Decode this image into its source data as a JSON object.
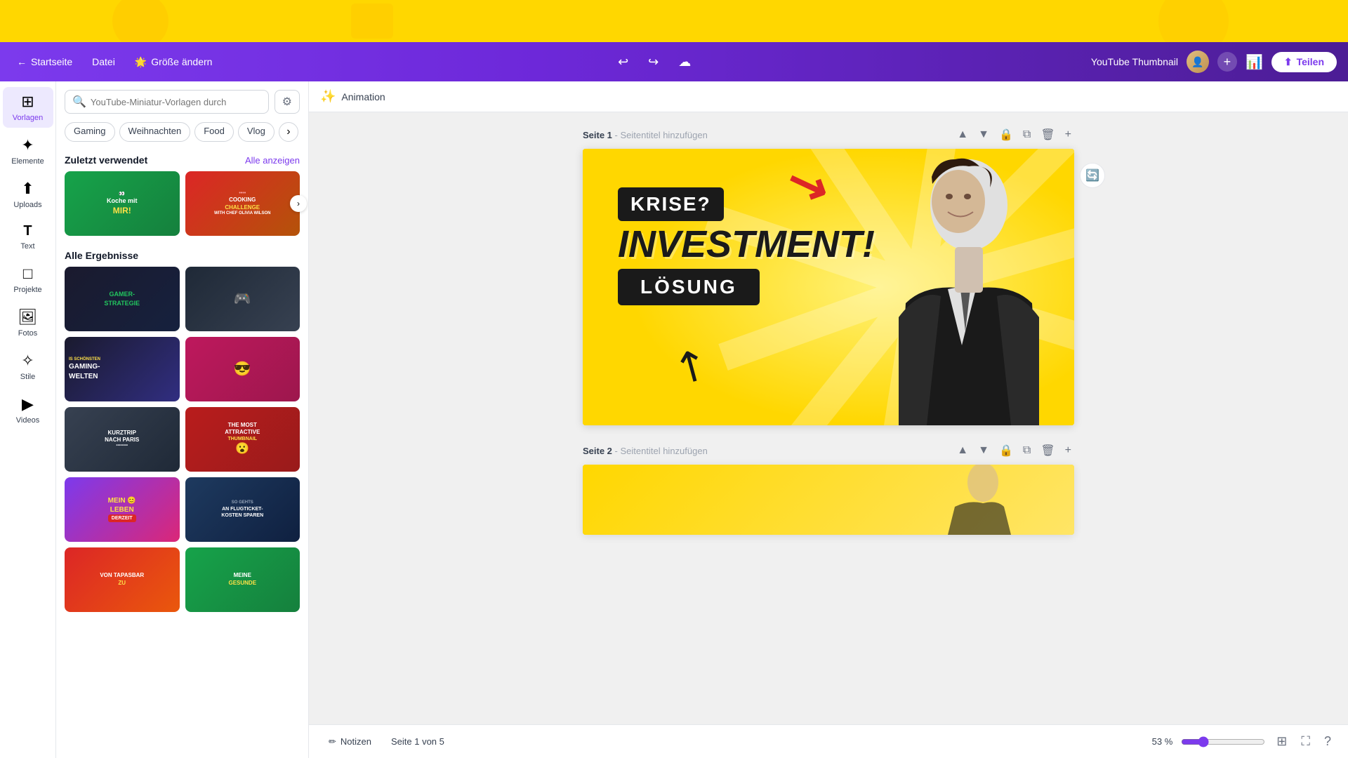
{
  "topBanner": {
    "visible": true
  },
  "header": {
    "back_label": "Startseite",
    "file_label": "Datei",
    "size_label": "Größe ändern",
    "doc_type": "YouTube Thumbnail",
    "share_label": "Teilen"
  },
  "sidebar": {
    "items": [
      {
        "id": "vorlagen",
        "label": "Vorlagen",
        "icon": "⊞"
      },
      {
        "id": "elemente",
        "label": "Elemente",
        "icon": "✦"
      },
      {
        "id": "uploads",
        "label": "Uploads",
        "icon": "⬆"
      },
      {
        "id": "text",
        "label": "Text",
        "icon": "T"
      },
      {
        "id": "projekte",
        "label": "Projekte",
        "icon": "□"
      },
      {
        "id": "fotos",
        "label": "Fotos",
        "icon": "🖼"
      },
      {
        "id": "stile",
        "label": "Stile",
        "icon": "✧"
      },
      {
        "id": "videos",
        "label": "Videos",
        "icon": "▶"
      }
    ]
  },
  "panel": {
    "search_placeholder": "YouTube-Miniatur-Vorlagen durch",
    "tags": [
      "Gaming",
      "Weihnachten",
      "Food",
      "Vlog"
    ],
    "recently_used_label": "Zuletzt verwendet",
    "see_all_label": "Alle anzeigen",
    "all_results_label": "Alle Ergebnisse",
    "templates_recent": [
      {
        "id": "koche-mit-mir",
        "label": "Koche mit MIR!",
        "style": "thumb-green"
      },
      {
        "id": "cooking-challenge",
        "label": "COOKING CHALLENGE",
        "style": "thumb-orange"
      }
    ],
    "templates_results": [
      {
        "id": "gamer-strategie",
        "label": "GAMER-STRATEGIE",
        "style": "t-dark"
      },
      {
        "id": "gaming-dunkel",
        "label": "",
        "style": "t-dark-gray"
      },
      {
        "id": "gaming-welten",
        "label": "GAMING-WELTEN",
        "style": "t-gaming"
      },
      {
        "id": "gaming-pink",
        "label": "IS SCHONSTEN",
        "style": "t-pink"
      },
      {
        "id": "kurztrip-paris",
        "label": "KURZTRIP NACH PARIS",
        "style": "t-paris"
      },
      {
        "id": "attractive",
        "label": "THE MOST ATTRACTIVE THUMBNAIL",
        "style": "t-red"
      },
      {
        "id": "mein-leben",
        "label": "MEIN LEBEN DERZEIT",
        "style": "t-colorful"
      },
      {
        "id": "flight",
        "label": "AN FLUGTICKET-KOSTEN SPAREN",
        "style": "t-flight"
      },
      {
        "id": "tapas",
        "label": "VON TAPASBAR ZU",
        "style": "t-vida"
      },
      {
        "id": "gesund",
        "label": "MEINE GESUNDE",
        "style": "t-gesund"
      }
    ]
  },
  "canvas": {
    "animation_label": "Animation",
    "pages": [
      {
        "id": "page1",
        "label": "Seite 1",
        "subtitle": "Seitentitel hinzufügen",
        "content": {
          "krise": "KRISE?",
          "invest": "INVESTMENT!",
          "losung": "LÖSUNG"
        }
      },
      {
        "id": "page2",
        "label": "Seite 2",
        "subtitle": "Seitentitel hinzufügen"
      }
    ],
    "total_pages": 5
  },
  "bottomBar": {
    "notes_label": "Notizen",
    "page_indicator": "Seite 1 von 5",
    "zoom": 53,
    "zoom_label": "53 %"
  }
}
